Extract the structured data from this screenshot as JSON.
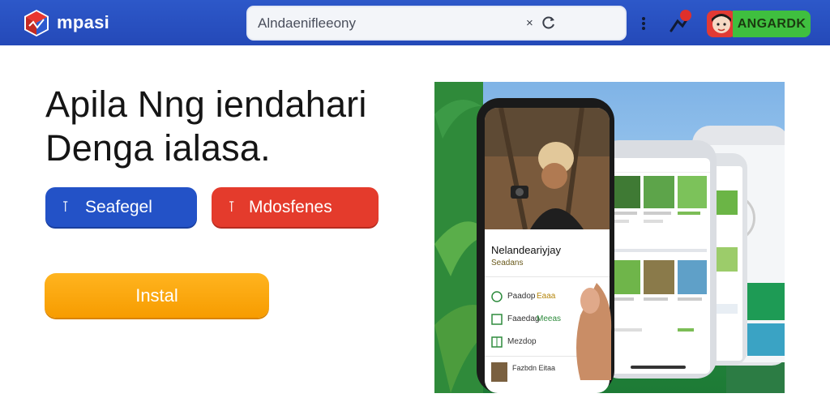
{
  "header": {
    "brand": "mpasi",
    "search": {
      "value": "Alndaenifleeony",
      "clear_glyph": "×"
    },
    "cta_label": "ANGARDK"
  },
  "hero": {
    "headline_line1": "Apila  Nng iendahari",
    "headline_line2": "Denga ialasa.",
    "btn_primary": {
      "glyph": "⊺",
      "label": "Seafegel"
    },
    "btn_secondary": {
      "glyph": "⊺",
      "label": "Mdosfenes"
    },
    "install_label": "Instal"
  },
  "promo": {
    "phone_title": "Nelandeariyjay",
    "phone_subtitle": "Seadans",
    "menu_items": [
      {
        "label": "Paadop",
        "badge": "Eaaa"
      },
      {
        "label": "Faaedag",
        "badge": "Meeas"
      },
      {
        "label": "Mezdop"
      }
    ],
    "footer_item": "Fazbdn Eitaa"
  },
  "colors": {
    "topbar": "#2449b8",
    "primary_button": "#2352c7",
    "secondary_button": "#e43b2c",
    "install_button": "#f79c00",
    "cta_top": "#3fbf3f"
  }
}
